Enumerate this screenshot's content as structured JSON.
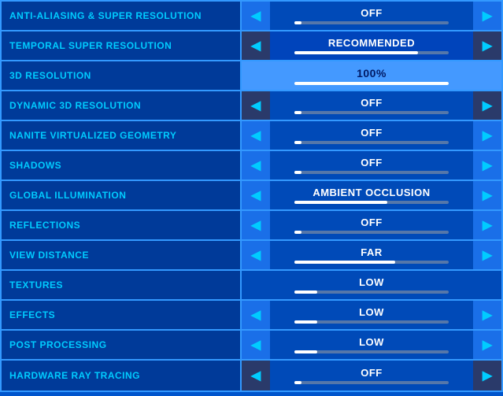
{
  "rows": [
    {
      "id": "anti-aliasing",
      "label": "ANTI-ALIASING & SUPER RESOLUTION",
      "value": "OFF",
      "barFill": 5,
      "hasArrows": true,
      "highlighted": false,
      "recommended": false
    },
    {
      "id": "temporal-super-resolution",
      "label": "TEMPORAL SUPER RESOLUTION",
      "value": "RECOMMENDED",
      "barFill": 80,
      "hasArrows": true,
      "highlighted": false,
      "recommended": true,
      "darkArrows": true
    },
    {
      "id": "3d-resolution",
      "label": "3D RESOLUTION",
      "value": "100%",
      "barFill": 100,
      "hasArrows": false,
      "highlighted": true,
      "recommended": false
    },
    {
      "id": "dynamic-3d-resolution",
      "label": "DYNAMIC 3D RESOLUTION",
      "value": "OFF",
      "barFill": 5,
      "hasArrows": true,
      "highlighted": false,
      "recommended": false,
      "darkArrows": true
    },
    {
      "id": "nanite",
      "label": "NANITE VIRTUALIZED GEOMETRY",
      "value": "OFF",
      "barFill": 5,
      "hasArrows": true,
      "highlighted": false,
      "recommended": false
    },
    {
      "id": "shadows",
      "label": "SHADOWS",
      "value": "OFF",
      "barFill": 5,
      "hasArrows": true,
      "highlighted": false,
      "recommended": false
    },
    {
      "id": "global-illumination",
      "label": "GLOBAL ILLUMINATION",
      "value": "AMBIENT OCCLUSION",
      "barFill": 60,
      "hasArrows": true,
      "highlighted": false,
      "recommended": false
    },
    {
      "id": "reflections",
      "label": "REFLECTIONS",
      "value": "OFF",
      "barFill": 5,
      "hasArrows": true,
      "highlighted": false,
      "recommended": false
    },
    {
      "id": "view-distance",
      "label": "VIEW DISTANCE",
      "value": "FAR",
      "barFill": 65,
      "hasArrows": true,
      "highlighted": false,
      "recommended": false
    },
    {
      "id": "textures",
      "label": "TEXTURES",
      "value": "LOW",
      "barFill": 15,
      "hasArrows": false,
      "highlighted": false,
      "recommended": false
    },
    {
      "id": "effects",
      "label": "EFFECTS",
      "value": "LOW",
      "barFill": 15,
      "hasArrows": true,
      "highlighted": false,
      "recommended": false
    },
    {
      "id": "post-processing",
      "label": "POST PROCESSING",
      "value": "LOW",
      "barFill": 15,
      "hasArrows": true,
      "highlighted": false,
      "recommended": false
    },
    {
      "id": "hardware-ray-tracing",
      "label": "HARDWARE RAY TRACING",
      "value": "OFF",
      "barFill": 5,
      "hasArrows": true,
      "highlighted": false,
      "recommended": false,
      "darkArrows": true
    }
  ],
  "ui": {
    "arrowLeft": "◀",
    "arrowRight": "▶"
  }
}
